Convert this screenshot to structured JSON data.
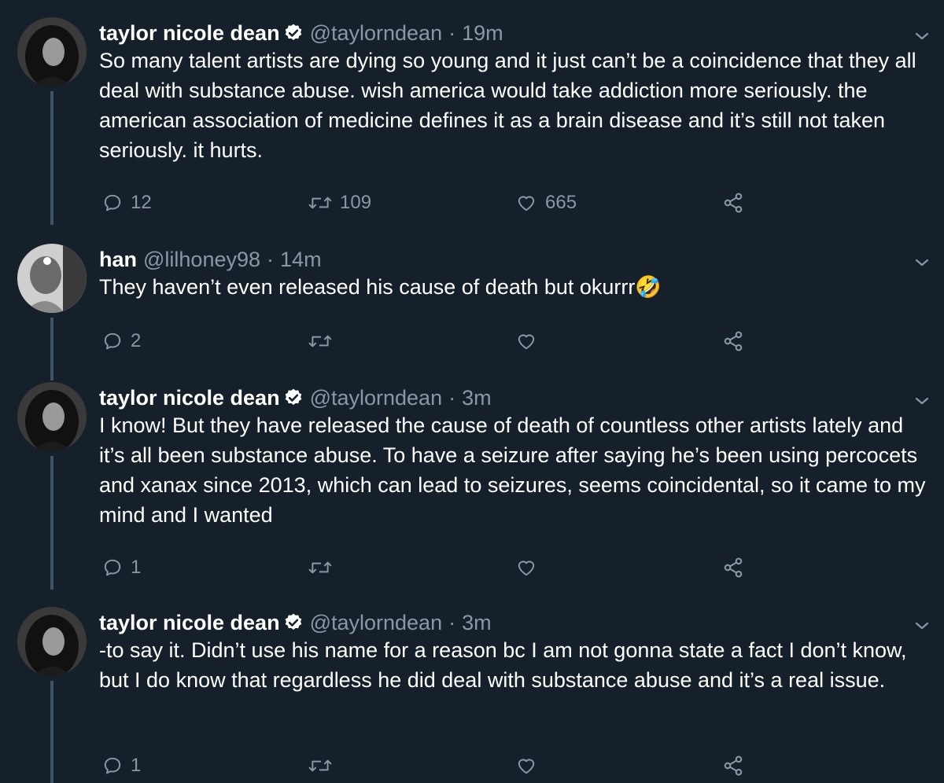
{
  "tweets": [
    {
      "name": "taylor nicole dean",
      "verified": true,
      "handle": "@taylorndean",
      "separator": "·",
      "time": "19m",
      "text": "So many talent artists are dying so young and it just can’t be a coincidence that they all deal with substance abuse. wish america would take addiction more seriously. the american association of medicine defines it as a brain disease and it’s still not taken seriously. it hurts.",
      "replies": "12",
      "retweets": "109",
      "likes": "665"
    },
    {
      "name": "han",
      "verified": false,
      "handle": "@lilhoney98",
      "separator": "·",
      "time": "14m",
      "text": "They haven’t even released his cause of death but okurrr🤣",
      "replies": "2",
      "retweets": "",
      "likes": ""
    },
    {
      "name": "taylor nicole dean",
      "verified": true,
      "handle": "@taylorndean",
      "separator": "·",
      "time": "3m",
      "text": "I know! But they have released the cause of death of countless other artists lately and it’s all been substance abuse. To have a seizure after saying he’s been using percocets and xanax since 2013, which can lead to seizures, seems coincidental, so it came to my mind and I wanted",
      "replies": "1",
      "retweets": "",
      "likes": ""
    },
    {
      "name": "taylor nicole dean",
      "verified": true,
      "handle": "@taylorndean",
      "separator": "·",
      "time": "3m",
      "text": "-to say it. Didn’t use his name for a reason bc I am not gonna state a fact I don’t know, but I do know that regardless he did deal with substance abuse and it’s a real issue.",
      "replies": "1",
      "retweets": "",
      "likes": ""
    }
  ],
  "icons": {
    "reply": "reply-icon",
    "retweet": "retweet-icon",
    "like": "like-icon",
    "share": "share-icon",
    "menu": "chevron-down-icon",
    "verified": "verified-badge-icon"
  },
  "colors": {
    "background": "#15202b",
    "text": "#ffffff",
    "muted": "#8899a6",
    "thread_line": "#3d5466"
  }
}
